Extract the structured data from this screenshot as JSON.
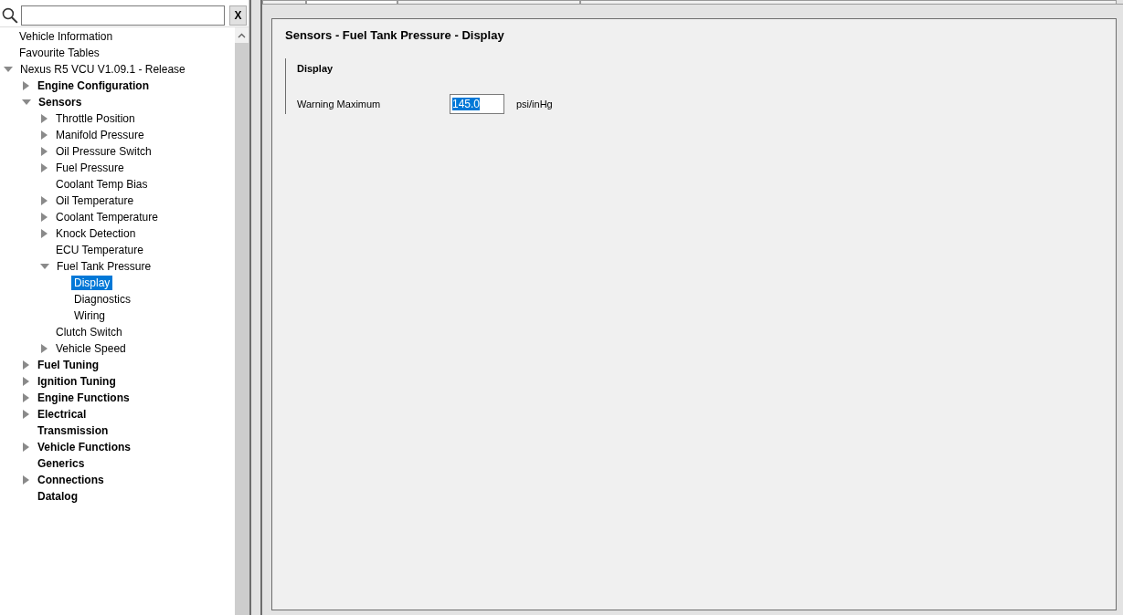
{
  "search": {
    "clear_label": "X"
  },
  "tree": [
    {
      "label": "Vehicle Information",
      "selected": false
    },
    {
      "label": "Favourite Tables",
      "selected": false
    },
    {
      "label": "Nexus R5 VCU V1.09.1 - Release",
      "expanded": true,
      "selected": false,
      "children": [
        {
          "label": "Engine Configuration",
          "expanded": false,
          "selected": false
        },
        {
          "label": "Sensors",
          "expanded": true,
          "selected": false,
          "children": [
            {
              "label": "Throttle Position",
              "expanded": false,
              "selected": false
            },
            {
              "label": "Manifold Pressure",
              "expanded": false,
              "selected": false
            },
            {
              "label": "Oil Pressure Switch",
              "expanded": false,
              "selected": false
            },
            {
              "label": "Fuel Pressure",
              "expanded": false,
              "selected": false
            },
            {
              "label": "Coolant Temp Bias",
              "selected": false
            },
            {
              "label": "Oil Temperature",
              "expanded": false,
              "selected": false
            },
            {
              "label": "Coolant Temperature",
              "expanded": false,
              "selected": false
            },
            {
              "label": "Knock Detection",
              "expanded": false,
              "selected": false
            },
            {
              "label": "ECU Temperature",
              "selected": false
            },
            {
              "label": "Fuel Tank Pressure",
              "expanded": true,
              "selected": false,
              "children": [
                {
                  "label": "Display",
                  "selected": true
                },
                {
                  "label": "Diagnostics",
                  "selected": false
                },
                {
                  "label": "Wiring",
                  "selected": false
                }
              ]
            },
            {
              "label": "Clutch Switch",
              "selected": false
            },
            {
              "label": "Vehicle Speed",
              "expanded": false,
              "selected": false
            }
          ]
        },
        {
          "label": "Fuel Tuning",
          "expanded": false,
          "selected": false
        },
        {
          "label": "Ignition Tuning",
          "expanded": false,
          "selected": false
        },
        {
          "label": "Engine Functions",
          "expanded": false,
          "selected": false
        },
        {
          "label": "Electrical",
          "expanded": false,
          "selected": false
        },
        {
          "label": "Transmission",
          "selected": false
        },
        {
          "label": "Vehicle Functions",
          "expanded": false,
          "selected": false
        },
        {
          "label": "Generics",
          "selected": false
        },
        {
          "label": "Connections",
          "expanded": false,
          "selected": false
        },
        {
          "label": "Datalog",
          "selected": false
        }
      ]
    }
  ],
  "tabs": [
    {
      "selected": false
    },
    {
      "selected": true
    },
    {
      "selected": false
    },
    {
      "selected": false
    }
  ],
  "panel": {
    "title": "Sensors - Fuel Tank Pressure - Display",
    "group": {
      "title": "Display",
      "fields": [
        {
          "label": "Warning Maximum",
          "value": "145.0",
          "unit": "psi/inHg",
          "text_selected": true
        }
      ]
    }
  }
}
